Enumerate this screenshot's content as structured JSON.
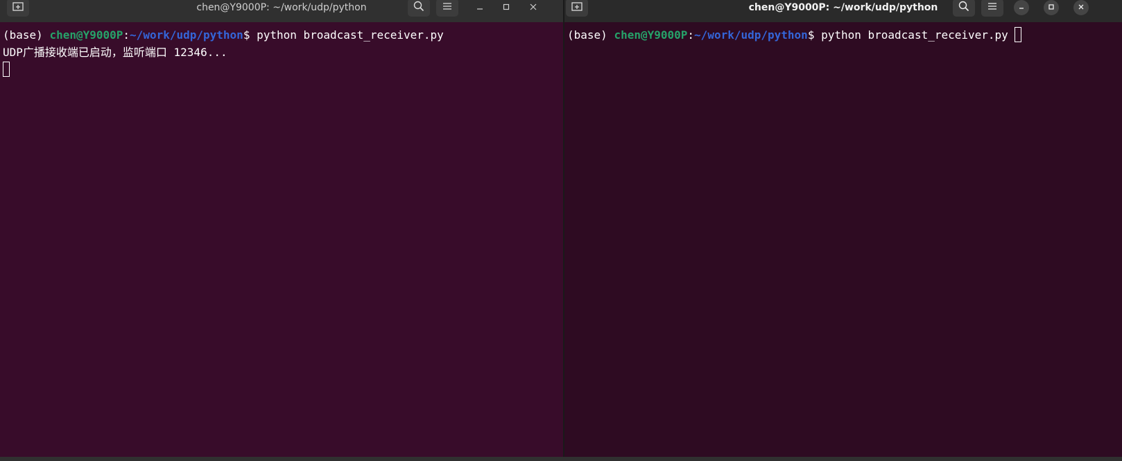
{
  "left_window": {
    "title": "chen@Y9000P: ~/work/udp/python",
    "new_tab_icon": "new-tab-icon",
    "search_icon": "search-icon",
    "menu_icon": "hamburger-menu-icon",
    "terminal": {
      "prompt_env": "(base) ",
      "prompt_user": "chen@Y9000P",
      "prompt_colon": ":",
      "prompt_path": "~/work/udp/python",
      "prompt_dollar": "$ ",
      "command": "python broadcast_receiver.py",
      "output_line": "UDP广播接收端已启动，监听端口 12346..."
    }
  },
  "right_window": {
    "title": "chen@Y9000P: ~/work/udp/python",
    "terminal": {
      "prompt_env": "(base) ",
      "prompt_user": "chen@Y9000P",
      "prompt_colon": ":",
      "prompt_path": "~/work/udp/python",
      "prompt_dollar": "$ ",
      "command": "python broadcast_receiver.py "
    }
  },
  "colors": {
    "left_bg": "#380c2a",
    "right_bg": "#2e0b22",
    "user_green": "#26a269",
    "path_blue": "#3465d8",
    "titlebar": "#303030"
  }
}
